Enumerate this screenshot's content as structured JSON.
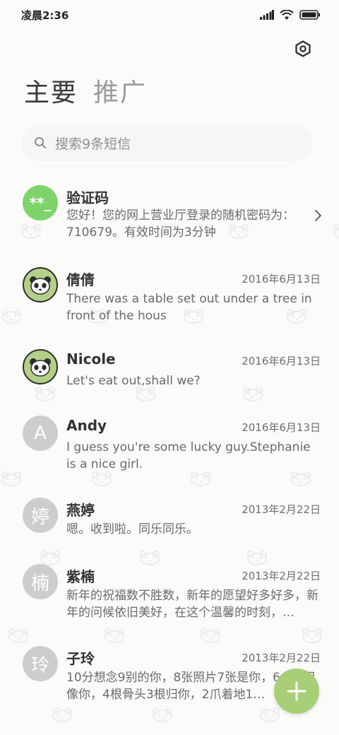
{
  "status_bar": {
    "time": "凌晨2:36"
  },
  "tabs": [
    {
      "label": "主要",
      "active": true
    },
    {
      "label": "推广",
      "active": false
    }
  ],
  "search": {
    "placeholder": "搜索9条短信"
  },
  "conversations": [
    {
      "name": "验证码",
      "avatar_text": "**_",
      "avatar_type": "green",
      "date": "",
      "preview": "您好！您的网上营业厅登录的随机密码为：710679。有效时间为3分钟",
      "has_chevron": true
    },
    {
      "name": "倩倩",
      "avatar_text": "",
      "avatar_type": "panda",
      "date": "2016年6月13日",
      "preview": "There was a table set out under a tree in front of the hous"
    },
    {
      "name": "Nicole",
      "avatar_text": "",
      "avatar_type": "panda",
      "date": "2016年6月13日",
      "preview": "Let's eat out,shall we?"
    },
    {
      "name": "Andy",
      "avatar_text": "A",
      "avatar_type": "gray",
      "date": "2016年6月13日",
      "preview": "I guess you're some lucky guy.Stephanie is a nice girl."
    },
    {
      "name": "燕婷",
      "avatar_text": "婷",
      "avatar_type": "gray",
      "date": "2013年2月22日",
      "preview": "嗯。收到啦。同乐同乐。"
    },
    {
      "name": "紫楠",
      "avatar_text": "楠",
      "avatar_type": "gray",
      "date": "2013年2月22日",
      "preview": "新年的祝福数不胜数，新年的愿望好多好多，新年的问候依旧美好，在这个温馨的时刻，…"
    },
    {
      "name": "子玲",
      "avatar_text": "玲",
      "avatar_type": "gray",
      "date": "2013年2月22日",
      "preview": "10分想念9别的你，8张照片7张是你，6… 5只像你，4根骨头3根归你，2爪着地1…"
    }
  ],
  "colors": {
    "accent_green": "#a8cf78",
    "code_avatar_green": "#7ed36b",
    "panda_avatar_green": "#b3d089",
    "gray_avatar": "#cdcdcb"
  },
  "icons": {
    "settings": "settings-hexagon-icon",
    "search": "search-icon",
    "chevron": "chevron-right-icon",
    "fab": "plus-icon"
  }
}
